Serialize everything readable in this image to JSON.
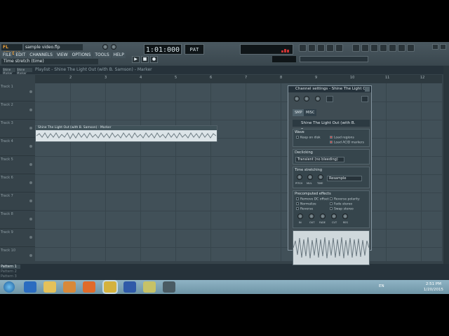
{
  "app": {
    "brand": "FL STUDIO",
    "file": "sample video.flp",
    "hint": "Time stretch (time)"
  },
  "menu": [
    "FILE",
    "EDIT",
    "CHANNELS",
    "VIEW",
    "OPTIONS",
    "TOOLS",
    "HELP"
  ],
  "transport": {
    "time": "1:01:000",
    "pat_label": "PAT"
  },
  "playlist": {
    "title": "Playlist - Shine The Light Out (with B. Samson) - Marker",
    "tab1": "Shine Marker",
    "tab2": "Shine Marker"
  },
  "ruler": [
    "2",
    "3",
    "4",
    "5",
    "6",
    "7",
    "8",
    "9",
    "10",
    "11",
    "12"
  ],
  "tracks": [
    "Track 1",
    "Track 2",
    "Track 3",
    "Track 4",
    "Track 5",
    "Track 6",
    "Track 7",
    "Track 8",
    "Track 9",
    "Track 10"
  ],
  "clip": {
    "label": "Shine The Light Out (with B. Samson) - Marker"
  },
  "patterns": [
    "Pattern 1",
    "Pattern 2",
    "Pattern 3"
  ],
  "channel_settings": {
    "title": "Channel settings - Shine The Light O...",
    "tab_samp": "SMP",
    "tab_misc": "MISC",
    "sample_name": "Shine The Light Out (with B. Samso...",
    "wave_label": "Wave",
    "keep_on_disk": "Keep on disk",
    "load_regions": "Load regions",
    "load_acid": "Load ACID markers",
    "declicking_label": "Declicking",
    "declick_mode": "Transient (no bleeding)",
    "time_stretching_label": "Time stretching",
    "stretch_mode": "Resample",
    "knob_labels_ts": [
      "PITCH",
      "MUL",
      "TIME"
    ],
    "precomputed_label": "Precomputed effects",
    "fx_left": [
      "Remove DC offset",
      "Normalize",
      "Reverse"
    ],
    "fx_right": [
      "Reverse polarity",
      "Fade stereo",
      "Swap stereo"
    ],
    "knob_labels_fx": [
      "IN",
      "OUT",
      "FADE",
      "CUT",
      "RES"
    ]
  },
  "taskbar": {
    "lang": "EN",
    "time": "2:51 PM",
    "date": "1/20/2015"
  },
  "colors": {
    "panel": "#36434a",
    "accent": "#f0a23a",
    "waveform": "#dce4e8"
  }
}
